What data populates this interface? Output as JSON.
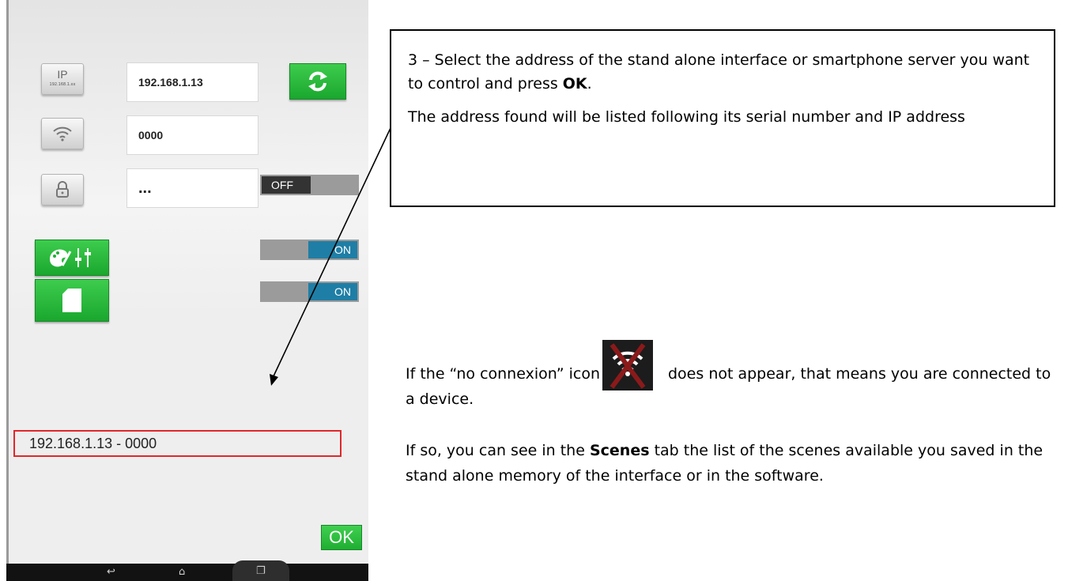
{
  "phone": {
    "ip_value": "192.168.1.13",
    "ip_icon_label": "192.168.1.xx",
    "password_value": "0000",
    "lock_value": "...",
    "lock_toggle": "OFF",
    "toggle_2": "ON",
    "toggle_3": "ON",
    "list_item": "192.168.1.13 - 0000",
    "ok_label": "OK"
  },
  "instructions": {
    "step_prefix": "3 – Select the address of the stand alone interface or smartphone server you want to control and press ",
    "step_ok": "OK",
    "step_suffix": ".",
    "address_note": "The address found will be listed following its serial number and IP address",
    "noconn_prefix": "If the “no connexion” icon",
    "noconn_suffix": "does not appear, that means you are connected to a device.",
    "scenes_prefix": "If so, you can see in the ",
    "scenes_bold": "Scenes",
    "scenes_suffix": " tab the list of the scenes available you saved in the stand alone memory of the interface or in the software."
  },
  "colors": {
    "accent_green": "#1fae31",
    "toggle_on": "#1f7ea5",
    "highlight_red": "#e0272b",
    "noconn_red": "#8b1a1a"
  }
}
